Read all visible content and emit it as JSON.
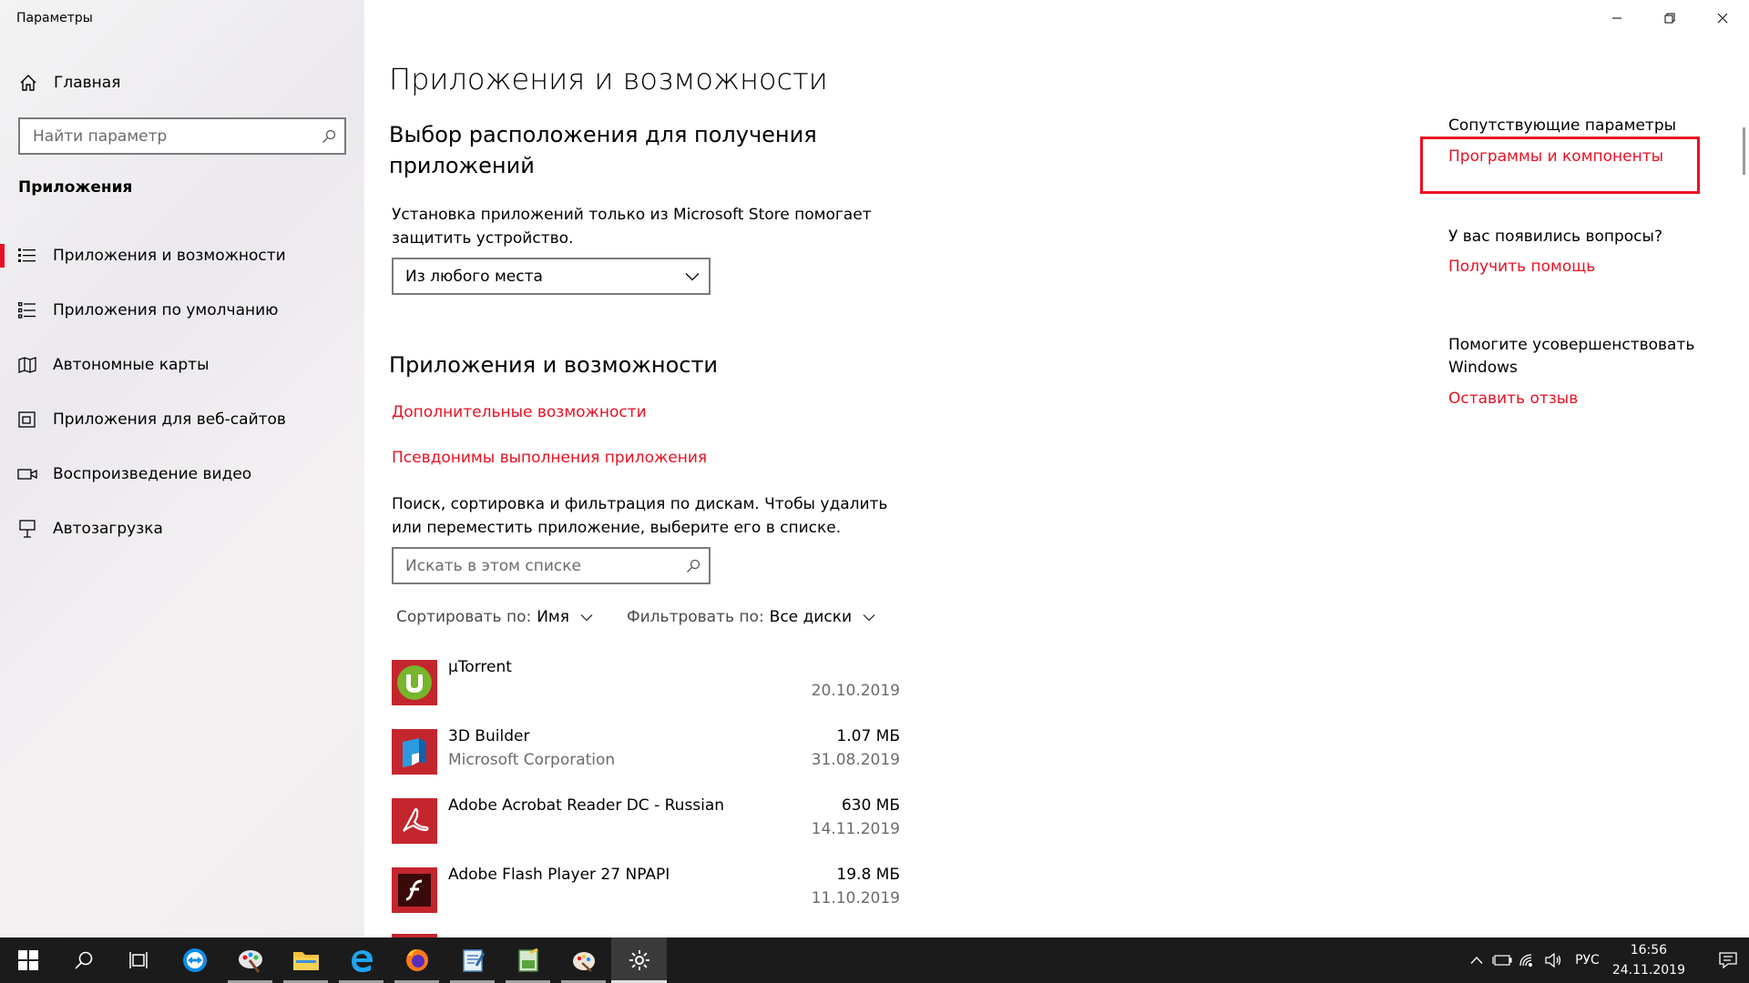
{
  "window": {
    "title": "Параметры"
  },
  "sidebar": {
    "home_label": "Главная",
    "search_placeholder": "Найти параметр",
    "section_title": "Приложения",
    "items": [
      {
        "label": "Приложения и возможности",
        "icon": "apps-features-icon",
        "active": true
      },
      {
        "label": "Приложения по умолчанию",
        "icon": "default-apps-icon",
        "active": false
      },
      {
        "label": "Автономные карты",
        "icon": "offline-maps-icon",
        "active": false
      },
      {
        "label": "Приложения для веб-сайтов",
        "icon": "apps-for-websites-icon",
        "active": false
      },
      {
        "label": "Воспроизведение видео",
        "icon": "video-playback-icon",
        "active": false
      },
      {
        "label": "Автозагрузка",
        "icon": "startup-icon",
        "active": false
      }
    ]
  },
  "main": {
    "page_title": "Приложения и возможности",
    "install_section": {
      "heading": "Выбор расположения для получения приложений",
      "description": "Установка приложений только из Microsoft Store помогает защитить устройство.",
      "dropdown_value": "Из любого места"
    },
    "apps_section": {
      "heading": "Приложения и возможности",
      "link_optional_features": "Дополнительные возможности",
      "link_app_aliases": "Псевдонимы выполнения приложения",
      "description": "Поиск, сортировка и фильтрация по дискам. Чтобы удалить или переместить приложение, выберите его в списке.",
      "search_placeholder": "Искать в этом списке",
      "sort_label": "Сортировать по:",
      "sort_value": "Имя",
      "filter_label": "Фильтровать по:",
      "filter_value": "Все диски"
    },
    "apps": [
      {
        "name": "µTorrent",
        "publisher": "",
        "size": "",
        "date": "20.10.2019",
        "icon": "utorrent-icon"
      },
      {
        "name": "3D Builder",
        "publisher": "Microsoft Corporation",
        "size": "1.07 МБ",
        "date": "31.08.2019",
        "icon": "3d-builder-icon"
      },
      {
        "name": "Adobe Acrobat Reader DC - Russian",
        "publisher": "",
        "size": "630 МБ",
        "date": "14.11.2019",
        "icon": "acrobat-reader-icon"
      },
      {
        "name": "Adobe Flash Player 27 NPAPI",
        "publisher": "",
        "size": "19.8 МБ",
        "date": "11.10.2019",
        "icon": "flash-player-icon"
      }
    ]
  },
  "related": {
    "heading": "Сопутствующие параметры",
    "programs_link": "Программы и компоненты",
    "questions_heading": "У вас появились вопросы?",
    "help_link": "Получить помощь",
    "improve_heading": "Помогите усовершенствовать Windows",
    "feedback_link": "Оставить отзыв"
  },
  "taskbar": {
    "apps": [
      "start-icon",
      "search-icon",
      "task-view-icon",
      "teamviewer-icon",
      "paint-app-icon",
      "file-explorer-icon",
      "edge-icon",
      "firefox-icon",
      "text-editor-icon",
      "notepad-icon",
      "paint3d-icon",
      "settings-gear-icon"
    ],
    "language": "РУС",
    "time": "16:56",
    "date": "24.11.2019"
  },
  "colors": {
    "accent": "#e81123",
    "taskbar": "#1b1b1b"
  }
}
